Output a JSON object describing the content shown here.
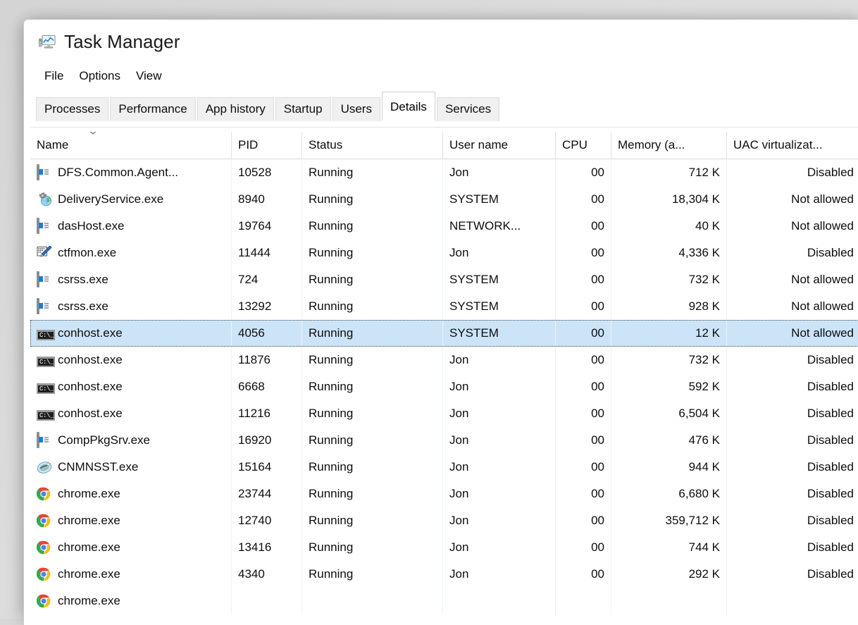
{
  "window": {
    "title": "Task Manager",
    "icon": "task-manager-icon"
  },
  "menubar": {
    "items": [
      {
        "label": "File"
      },
      {
        "label": "Options"
      },
      {
        "label": "View"
      }
    ]
  },
  "tabs": [
    {
      "label": "Processes",
      "active": false
    },
    {
      "label": "Performance",
      "active": false
    },
    {
      "label": "App history",
      "active": false
    },
    {
      "label": "Startup",
      "active": false
    },
    {
      "label": "Users",
      "active": false
    },
    {
      "label": "Details",
      "active": true
    },
    {
      "label": "Services",
      "active": false
    }
  ],
  "table": {
    "sort": {
      "column": "Name",
      "direction": "descending",
      "indicator": "chevron-down-icon"
    },
    "columns": [
      {
        "key": "name",
        "label": "Name",
        "align": "left"
      },
      {
        "key": "pid",
        "label": "PID",
        "align": "left"
      },
      {
        "key": "status",
        "label": "Status",
        "align": "left"
      },
      {
        "key": "user",
        "label": "User name",
        "align": "left"
      },
      {
        "key": "cpu",
        "label": "CPU",
        "align": "left"
      },
      {
        "key": "memory",
        "label": "Memory (a...",
        "align": "left"
      },
      {
        "key": "uac",
        "label": "UAC virtualizat...",
        "align": "left"
      }
    ],
    "rows": [
      {
        "icon": "window-doc-icon",
        "name": "DFS.Common.Agent...",
        "pid": "10528",
        "status": "Running",
        "user": "Jon",
        "cpu": "00",
        "memory": "712 K",
        "uac": "Disabled",
        "selected": false
      },
      {
        "icon": "gear-globe-icon",
        "name": "DeliveryService.exe",
        "pid": "8940",
        "status": "Running",
        "user": "SYSTEM",
        "cpu": "00",
        "memory": "18,304 K",
        "uac": "Not allowed",
        "selected": false
      },
      {
        "icon": "window-doc-icon",
        "name": "dasHost.exe",
        "pid": "19764",
        "status": "Running",
        "user": "NETWORK...",
        "cpu": "00",
        "memory": "40 K",
        "uac": "Not allowed",
        "selected": false
      },
      {
        "icon": "pen-notepad-icon",
        "name": "ctfmon.exe",
        "pid": "11444",
        "status": "Running",
        "user": "Jon",
        "cpu": "00",
        "memory": "4,336 K",
        "uac": "Disabled",
        "selected": false
      },
      {
        "icon": "window-doc-icon",
        "name": "csrss.exe",
        "pid": "724",
        "status": "Running",
        "user": "SYSTEM",
        "cpu": "00",
        "memory": "732 K",
        "uac": "Not allowed",
        "selected": false
      },
      {
        "icon": "window-doc-icon",
        "name": "csrss.exe",
        "pid": "13292",
        "status": "Running",
        "user": "SYSTEM",
        "cpu": "00",
        "memory": "928 K",
        "uac": "Not allowed",
        "selected": false
      },
      {
        "icon": "console-icon",
        "name": "conhost.exe",
        "pid": "4056",
        "status": "Running",
        "user": "SYSTEM",
        "cpu": "00",
        "memory": "12 K",
        "uac": "Not allowed",
        "selected": true
      },
      {
        "icon": "console-icon",
        "name": "conhost.exe",
        "pid": "11876",
        "status": "Running",
        "user": "Jon",
        "cpu": "00",
        "memory": "732 K",
        "uac": "Disabled",
        "selected": false
      },
      {
        "icon": "console-icon",
        "name": "conhost.exe",
        "pid": "6668",
        "status": "Running",
        "user": "Jon",
        "cpu": "00",
        "memory": "592 K",
        "uac": "Disabled",
        "selected": false
      },
      {
        "icon": "console-icon",
        "name": "conhost.exe",
        "pid": "11216",
        "status": "Running",
        "user": "Jon",
        "cpu": "00",
        "memory": "6,504 K",
        "uac": "Disabled",
        "selected": false
      },
      {
        "icon": "window-doc-icon",
        "name": "CompPkgSrv.exe",
        "pid": "16920",
        "status": "Running",
        "user": "Jon",
        "cpu": "00",
        "memory": "476 K",
        "uac": "Disabled",
        "selected": false
      },
      {
        "icon": "scanner-icon",
        "name": "CNMNSST.exe",
        "pid": "15164",
        "status": "Running",
        "user": "Jon",
        "cpu": "00",
        "memory": "944 K",
        "uac": "Disabled",
        "selected": false
      },
      {
        "icon": "chrome-icon",
        "name": "chrome.exe",
        "pid": "23744",
        "status": "Running",
        "user": "Jon",
        "cpu": "00",
        "memory": "6,680 K",
        "uac": "Disabled",
        "selected": false
      },
      {
        "icon": "chrome-icon",
        "name": "chrome.exe",
        "pid": "12740",
        "status": "Running",
        "user": "Jon",
        "cpu": "00",
        "memory": "359,712 K",
        "uac": "Disabled",
        "selected": false
      },
      {
        "icon": "chrome-icon",
        "name": "chrome.exe",
        "pid": "13416",
        "status": "Running",
        "user": "Jon",
        "cpu": "00",
        "memory": "744 K",
        "uac": "Disabled",
        "selected": false
      },
      {
        "icon": "chrome-icon",
        "name": "chrome.exe",
        "pid": "4340",
        "status": "Running",
        "user": "Jon",
        "cpu": "00",
        "memory": "292 K",
        "uac": "Disabled",
        "selected": false
      },
      {
        "icon": "chrome-icon",
        "name": "chrome.exe",
        "pid": "",
        "status": "",
        "user": "",
        "cpu": "",
        "memory": "",
        "uac": "",
        "selected": false
      }
    ]
  },
  "colors": {
    "selection": "#cce4f7",
    "accent_blue": "#1a7fd4",
    "window_bg": "#ffffff",
    "desktop_bg": "#d8d8d8"
  }
}
